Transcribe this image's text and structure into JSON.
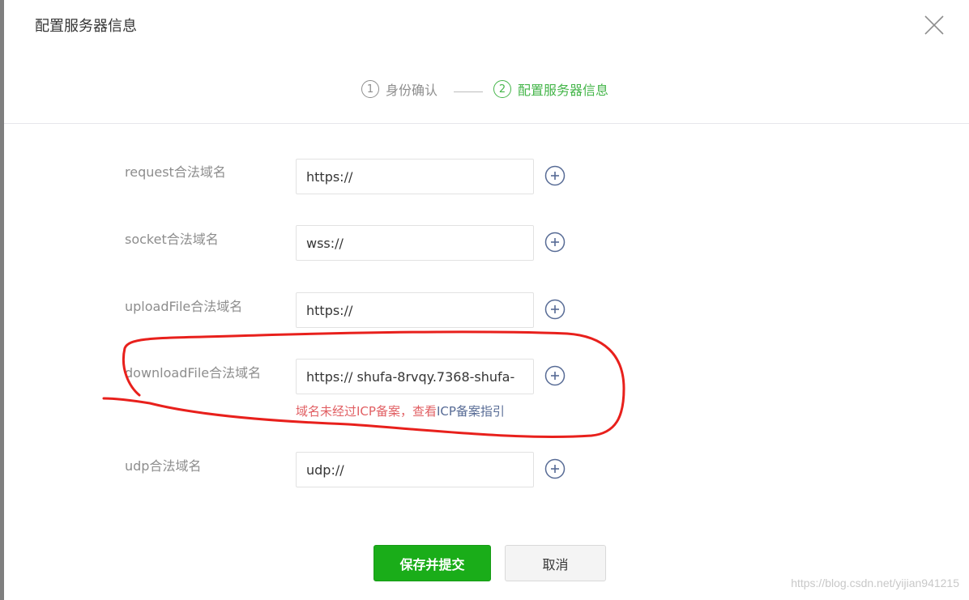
{
  "dialog": {
    "title": "配置服务器信息",
    "close_icon": "close-icon"
  },
  "steps": [
    {
      "number": "1",
      "label": "身份确认",
      "state": "done"
    },
    {
      "number": "2",
      "label": "配置服务器信息",
      "state": "active"
    }
  ],
  "fields": [
    {
      "label": "request合法域名",
      "value": "https://"
    },
    {
      "label": "socket合法域名",
      "value": "wss://"
    },
    {
      "label": "uploadFile合法域名",
      "value": "https://"
    },
    {
      "label": "downloadFile合法域名",
      "value": "https:// shufa-8rvqy.7368-shufa-",
      "error": "域名未经过ICP备案，查看",
      "error_link": "ICP备案指引"
    },
    {
      "label": "udp合法域名",
      "value": "udp://"
    }
  ],
  "buttons": {
    "submit_label": "保存并提交",
    "cancel_label": "取消"
  },
  "watermark": "https://blog.csdn.net/yijian941215",
  "colors": {
    "primary": "#1aad19",
    "active_step": "#44b549",
    "error": "#e15f63",
    "link": "#576b95",
    "annotation": "#e8201c"
  }
}
